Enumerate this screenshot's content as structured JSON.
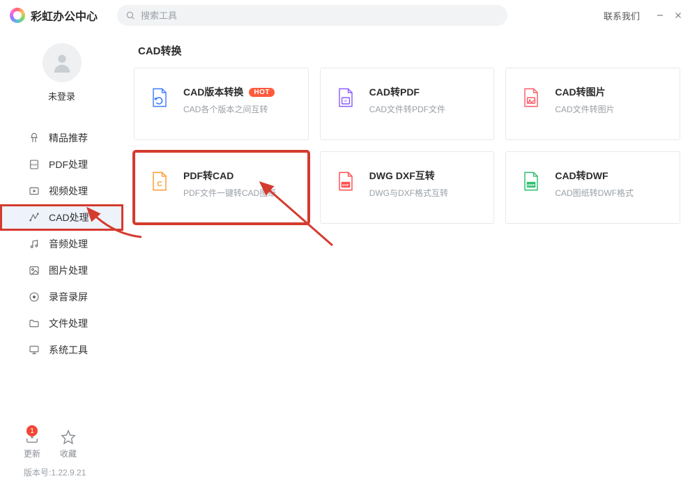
{
  "titlebar": {
    "app_title": "彩虹办公中心",
    "search_placeholder": "搜索工具",
    "contact_us": "联系我们"
  },
  "sidebar": {
    "login_status": "未登录",
    "nav": [
      {
        "id": "recommend",
        "label": "精品推荐"
      },
      {
        "id": "pdf",
        "label": "PDF处理"
      },
      {
        "id": "video",
        "label": "视频处理"
      },
      {
        "id": "cad",
        "label": "CAD处理",
        "active": true,
        "highlighted": true
      },
      {
        "id": "audio",
        "label": "音频处理"
      },
      {
        "id": "image",
        "label": "图片处理"
      },
      {
        "id": "record",
        "label": "录音录屏"
      },
      {
        "id": "file",
        "label": "文件处理"
      },
      {
        "id": "system",
        "label": "系统工具"
      }
    ],
    "footer": {
      "update_label": "更新",
      "update_badge": "1",
      "favorite_label": "收藏",
      "version_prefix": "版本号:",
      "version": "1.22.9.21"
    }
  },
  "main": {
    "section_title": "CAD转换",
    "cards": [
      {
        "id": "cad-version",
        "title": "CAD版本转换",
        "sub": "CAD各个版本之间互转",
        "color": "#3f7bff",
        "hot": true
      },
      {
        "id": "cad-to-pdf",
        "title": "CAD转PDF",
        "sub": "CAD文件转PDF文件",
        "color": "#8a5cff"
      },
      {
        "id": "cad-to-img",
        "title": "CAD转图片",
        "sub": "CAD文件转图片",
        "color": "#ff5a6a"
      },
      {
        "id": "pdf-to-cad",
        "title": "PDF转CAD",
        "sub": "PDF文件一键转CAD图纸",
        "color": "#ff9a2e",
        "highlighted": true
      },
      {
        "id": "dwg-dxf",
        "title": "DWG DXF互转",
        "sub": "DWG与DXF格式互转",
        "color": "#ff4d4d"
      },
      {
        "id": "cad-to-dwf",
        "title": "CAD转DWF",
        "sub": "CAD图纸转DWF格式",
        "color": "#2bbf6e"
      }
    ]
  }
}
